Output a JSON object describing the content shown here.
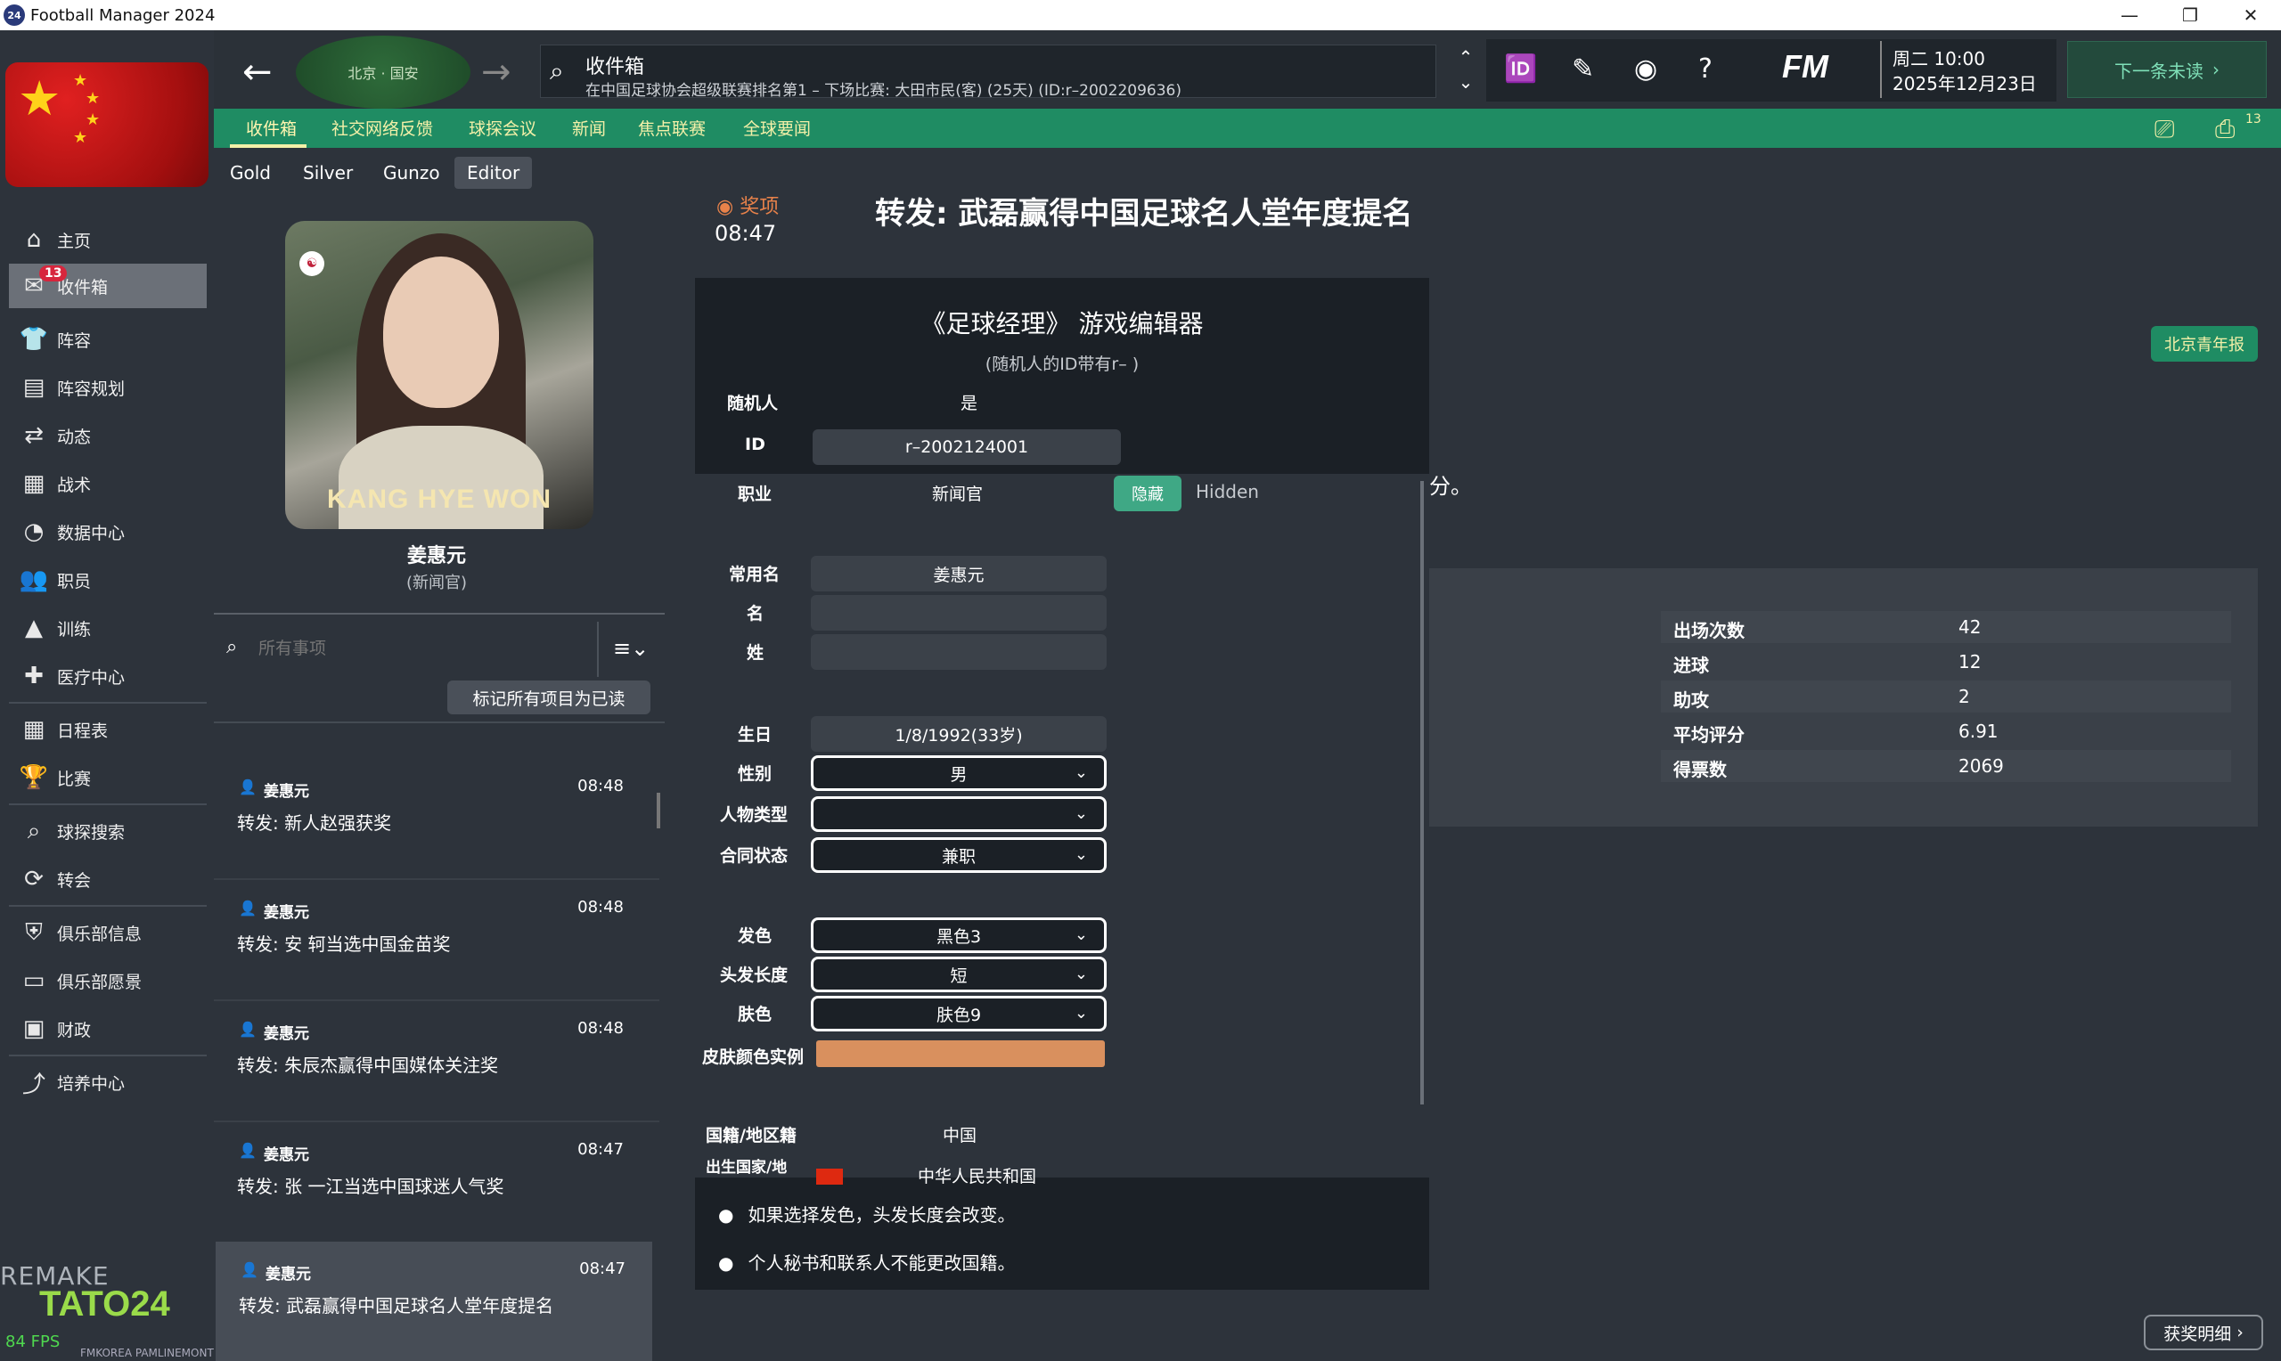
{
  "window": {
    "title": "Football Manager 2024",
    "app_icon": "24",
    "controls": [
      "—",
      "❐",
      "✕"
    ]
  },
  "topbar": {
    "search_title": "收件箱",
    "search_subtitle": "在中国足球协会超级联赛排名第1 – 下场比赛: 大田市民(客) (25天) (ID:r–2002209636)",
    "club_logo_text": "北京 · 国安",
    "date_line1": "周二 10:00",
    "date_line2": "2025年12月23日",
    "fm_logo": "FM",
    "next_button": "下一条未读"
  },
  "subnav": {
    "tabs": [
      "收件箱",
      "社交网络反馈",
      "球探会议",
      "新闻",
      "焦点联赛",
      "全球要闻"
    ],
    "right_badge": "13"
  },
  "sidebar": {
    "items": [
      {
        "label": "主页",
        "icon": "home-icon"
      },
      {
        "label": "收件箱",
        "icon": "inbox-icon",
        "badge": "13"
      },
      {
        "label": "阵容",
        "icon": "shirt-icon"
      },
      {
        "label": "阵容规划",
        "icon": "clipboard-icon"
      },
      {
        "label": "动态",
        "icon": "dynamics-icon"
      },
      {
        "label": "战术",
        "icon": "tactics-icon"
      },
      {
        "label": "数据中心",
        "icon": "data-icon"
      },
      {
        "label": "职员",
        "icon": "staff-icon"
      },
      {
        "label": "训练",
        "icon": "training-icon"
      },
      {
        "label": "医疗中心",
        "icon": "medical-icon"
      },
      {
        "label": "日程表",
        "icon": "calendar-icon"
      },
      {
        "label": "比赛",
        "icon": "trophy-icon"
      },
      {
        "label": "球探搜索",
        "icon": "search-icon"
      },
      {
        "label": "转会",
        "icon": "transfer-icon"
      },
      {
        "label": "俱乐部信息",
        "icon": "shield-icon"
      },
      {
        "label": "俱乐部愿景",
        "icon": "vision-icon"
      },
      {
        "label": "财政",
        "icon": "finance-icon"
      },
      {
        "label": "培养中心",
        "icon": "development-icon"
      }
    ],
    "remake": "REMAKE",
    "tato": "TATO24",
    "fps": "84 FPS",
    "credit": "FMKOREA PAMLINEMONT"
  },
  "leftpanel": {
    "tabs": [
      "Gold",
      "Silver",
      "Gunzo",
      "Editor"
    ],
    "portrait_name": "KANG HYE WON",
    "person_name": "姜惠元",
    "person_role": "(新闻官)",
    "search_placeholder": "所有事项",
    "mark_all": "标记所有项目为已读",
    "messages": [
      {
        "sender": "姜惠元",
        "time": "08:48",
        "subject": "转发:  新人赵强获奖"
      },
      {
        "sender": "姜惠元",
        "time": "08:48",
        "subject": "转发:  安 轲当选中国金苗奖"
      },
      {
        "sender": "姜惠元",
        "time": "08:48",
        "subject": "转发:  朱辰杰赢得中国媒体关注奖"
      },
      {
        "sender": "姜惠元",
        "time": "08:47",
        "subject": "转发:  张 一江当选中国球迷人气奖"
      },
      {
        "sender": "姜惠元",
        "time": "08:47",
        "subject": "转发:  武磊赢得中国足球名人堂年度提名"
      }
    ]
  },
  "article": {
    "tag": "奖项",
    "time": "08:47",
    "headline": "转发:   武磊赢得中国足球名人堂年度提名",
    "newspaper": "北京青年报",
    "text_fragment": "分。",
    "stats": [
      {
        "key": "出场次数",
        "value": "42"
      },
      {
        "key": "进球",
        "value": "12"
      },
      {
        "key": "助攻",
        "value": "2"
      },
      {
        "key": "平均评分",
        "value": "6.91"
      },
      {
        "key": "得票数",
        "value": "2069"
      }
    ],
    "awards_button": "获奖明细"
  },
  "editor": {
    "title": "《足球经理》 游戏编辑器",
    "subtitle": "(随机人的ID带有r– )",
    "random_label": "随机人",
    "random_value": "是",
    "id_label": "ID",
    "id_value": "r–2002124001",
    "job_label": "职业",
    "job_value": "新闻官",
    "hide_button": "隐藏",
    "hidden_label": "Hidden",
    "common_name_label": "常用名",
    "common_name_value": "姜惠元",
    "first_name_label": "名",
    "first_name_value": "",
    "last_name_label": "姓",
    "last_name_value": "",
    "birth_label": "生日",
    "birth_value": "1/8/1992(33岁)",
    "gender_label": "性别",
    "gender_value": "男",
    "persona_label": "人物类型",
    "persona_value": "",
    "contract_label": "合同状态",
    "contract_value": "兼职",
    "hair_color_label": "发色",
    "hair_color_value": "黑色3",
    "hair_length_label": "头发长度",
    "hair_length_value": "短",
    "skin_label": "肤色",
    "skin_value": "肤色9",
    "skin_sample_label": "皮肤颜色实例",
    "skin_sample_color": "#d9905e",
    "nationality_label": "国籍/地区籍",
    "nationality_value": "中国",
    "birth_country_label": "出生国家/地",
    "birth_country_value": "中华人民共和国",
    "notes": [
      "如果选择发色，头发长度会改变。",
      "个人秘书和联系人不能更改国籍。"
    ]
  },
  "colors": {
    "green_accent": "#1f8c63",
    "award_orange": "#e8824a",
    "badge_red": "#d7263d"
  }
}
